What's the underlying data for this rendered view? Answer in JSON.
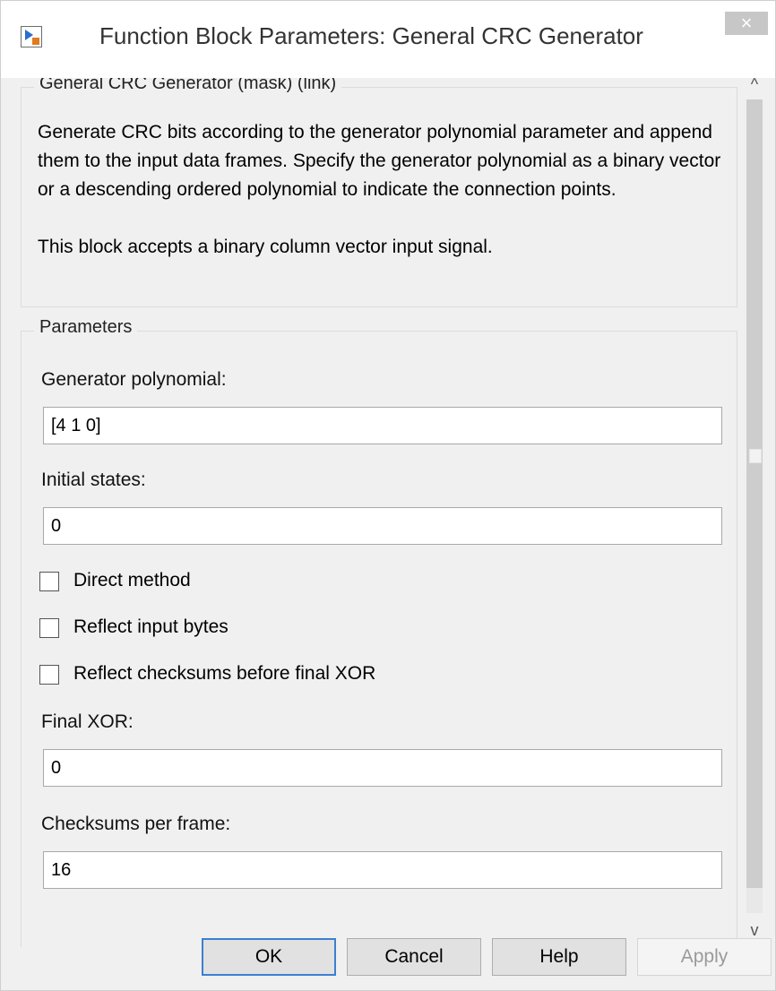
{
  "window": {
    "title": "Function Block Parameters: General CRC Generator",
    "close_symbol": "×"
  },
  "description": {
    "legend": "General CRC Generator (mask) (link)",
    "paragraph1": "Generate CRC bits according to the generator polynomial parameter and append them to the input data frames. Specify the generator polynomial as a binary vector or a descending ordered polynomial to indicate the connection points.",
    "paragraph2": "This block accepts a binary column vector input signal."
  },
  "parameters": {
    "legend": "Parameters",
    "generator_polynomial": {
      "label": "Generator polynomial:",
      "value": "[4 1 0]"
    },
    "initial_states": {
      "label": "Initial states:",
      "value": "0"
    },
    "direct_method": {
      "label": "Direct method",
      "checked": false
    },
    "reflect_input_bytes": {
      "label": "Reflect input bytes",
      "checked": false
    },
    "reflect_checksums": {
      "label": "Reflect checksums before final XOR",
      "checked": false
    },
    "final_xor": {
      "label": "Final XOR:",
      "value": "0"
    },
    "checksums_per_frame": {
      "label": "Checksums per frame:",
      "value": "16"
    }
  },
  "scrollbar": {
    "up_symbol": "^",
    "down_symbol": "v"
  },
  "buttons": {
    "ok": "OK",
    "cancel": "Cancel",
    "help": "Help",
    "apply": "Apply"
  },
  "icons": {
    "app": "simulink-block-icon",
    "close": "close-icon"
  },
  "colors": {
    "ok_border": "#3c7fd1",
    "close_bg": "#c7c7c7"
  }
}
